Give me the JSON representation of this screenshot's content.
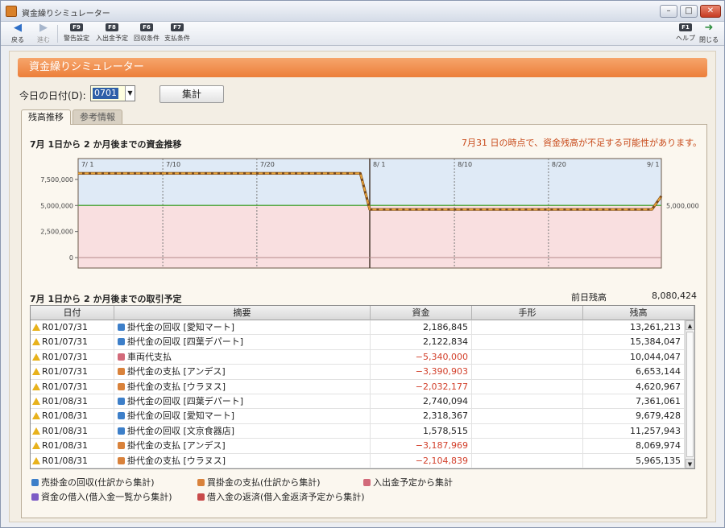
{
  "window": {
    "title": "資金繰りシミュレーター",
    "buttons": {
      "minimize": "–",
      "maximize": "□",
      "close": "✕"
    }
  },
  "toolbar": {
    "back": {
      "label": "戻る"
    },
    "forward": {
      "label": "進む"
    },
    "items": [
      {
        "key": "F9",
        "label": "警告設定"
      },
      {
        "key": "F8",
        "label": "入出金予定"
      },
      {
        "key": "F6",
        "label": "回収条件"
      },
      {
        "key": "F7",
        "label": "支払条件"
      }
    ],
    "help": {
      "key": "F1",
      "label": "ヘルプ"
    },
    "close": {
      "label": "閉じる"
    }
  },
  "header": {
    "title": "資金繰りシミュレーター"
  },
  "controls": {
    "date_label": "今日の日付(D):",
    "date_value": "0701",
    "calc_button": "集計"
  },
  "tabs": [
    {
      "label": "残高推移",
      "active": true
    },
    {
      "label": "参考情報",
      "active": false
    }
  ],
  "chart": {
    "title": "7月 1日から 2 か月後までの資金推移",
    "warning": "7月31 日の時点で、資金残高が不足する可能性があります。",
    "chart_data": {
      "type": "line",
      "y_ticks": [
        "7,500,000",
        "5,000,000",
        "2,500,000",
        "0"
      ],
      "date_ticks": [
        "7/ 1",
        "7/10",
        "7/20",
        "8/ 1",
        "8/10",
        "8/20",
        "9/ 1"
      ],
      "threshold_label": "5,000,000",
      "threshold": 5000000,
      "ylim": [
        -1000000,
        9500000
      ],
      "xlim": [
        1,
        63
      ],
      "series": [
        {
          "x": [
            1,
            31,
            32,
            62,
            63
          ],
          "y": [
            8080424,
            8080424,
            4620967,
            4620967,
            5900000
          ]
        }
      ]
    }
  },
  "transactions": {
    "title": "7月 1日から 2 か月後までの取引予定",
    "prev_balance_label": "前日残高",
    "prev_balance_value": "8,080,424",
    "columns": [
      "日付",
      "摘要",
      "資金",
      "手形",
      "残高"
    ],
    "rows": [
      {
        "date": "R01/07/31",
        "icon": "collect",
        "desc": "掛代金の回収 [愛知マート]",
        "cash": "2,186,845",
        "neg": false,
        "note": "",
        "balance": "13,261,213"
      },
      {
        "date": "R01/07/31",
        "icon": "collect",
        "desc": "掛代金の回収 [四葉デパート]",
        "cash": "2,122,834",
        "neg": false,
        "note": "",
        "balance": "15,384,047"
      },
      {
        "date": "R01/07/31",
        "icon": "car",
        "desc": "車両代支払",
        "cash": "−5,340,000",
        "neg": true,
        "note": "",
        "balance": "10,044,047"
      },
      {
        "date": "R01/07/31",
        "icon": "pay",
        "desc": "掛代金の支払 [アンデス]",
        "cash": "−3,390,903",
        "neg": true,
        "note": "",
        "balance": "6,653,144"
      },
      {
        "date": "R01/07/31",
        "icon": "pay",
        "desc": "掛代金の支払 [ウラヌス]",
        "cash": "−2,032,177",
        "neg": true,
        "note": "",
        "balance": "4,620,967"
      },
      {
        "date": "R01/08/31",
        "icon": "collect",
        "desc": "掛代金の回収 [四葉デパート]",
        "cash": "2,740,094",
        "neg": false,
        "note": "",
        "balance": "7,361,061"
      },
      {
        "date": "R01/08/31",
        "icon": "collect",
        "desc": "掛代金の回収 [愛知マート]",
        "cash": "2,318,367",
        "neg": false,
        "note": "",
        "balance": "9,679,428"
      },
      {
        "date": "R01/08/31",
        "icon": "collect",
        "desc": "掛代金の回収 [文京食器店]",
        "cash": "1,578,515",
        "neg": false,
        "note": "",
        "balance": "11,257,943"
      },
      {
        "date": "R01/08/31",
        "icon": "pay",
        "desc": "掛代金の支払 [アンデス]",
        "cash": "−3,187,969",
        "neg": true,
        "note": "",
        "balance": "8,069,974"
      },
      {
        "date": "R01/08/31",
        "icon": "pay",
        "desc": "掛代金の支払 [ウラヌス]",
        "cash": "−2,104,839",
        "neg": true,
        "note": "",
        "balance": "5,965,135"
      }
    ]
  },
  "legend": [
    {
      "icon": "collect",
      "label": "売掛金の回収(仕訳から集計)"
    },
    {
      "icon": "pay",
      "label": "買掛金の支払(仕訳から集計)"
    },
    {
      "icon": "car",
      "label": "入出金予定から集計"
    },
    {
      "icon": "borrow",
      "label": "資金の借入(借入金一覧から集計)"
    },
    {
      "icon": "repay",
      "label": "借入金の返済(借入金返済予定から集計)"
    }
  ],
  "colors": {
    "accent": "#ec7f3a",
    "negative": "#d23f2a",
    "line": "#e8a33a",
    "zone_safe": "#dfeaf6",
    "zone_short": "#f9dfe0",
    "threshold": "#5aa845"
  }
}
